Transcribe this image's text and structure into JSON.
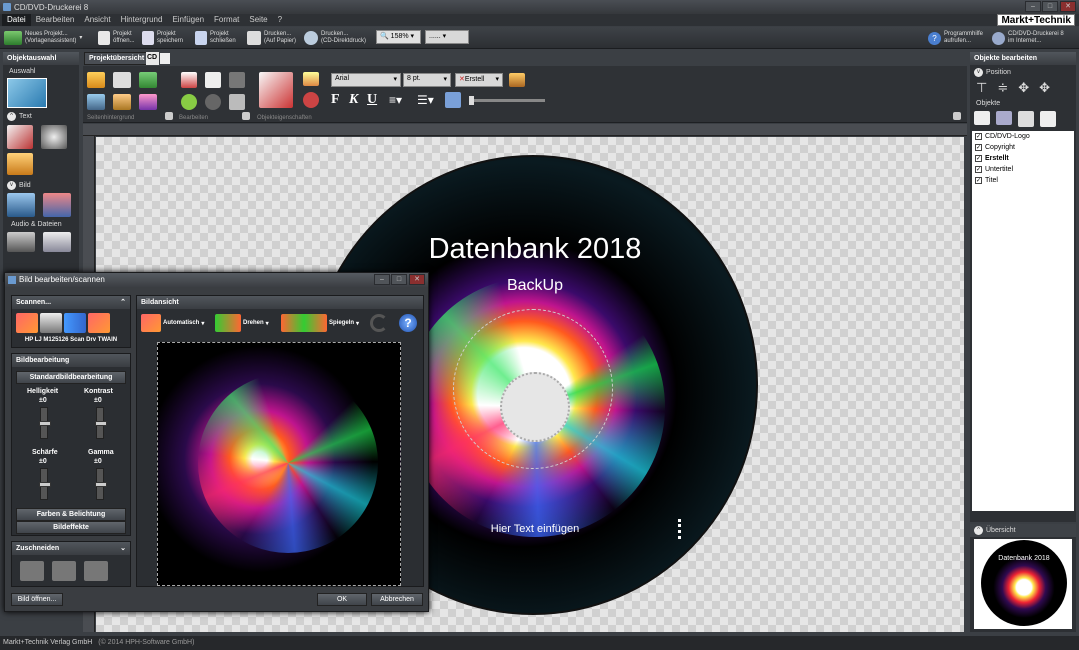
{
  "window": {
    "title": "CD/DVD-Druckerei 8"
  },
  "menu": {
    "items": [
      "Datei",
      "Bearbeiten",
      "Ansicht",
      "Hintergrund",
      "Einfügen",
      "Format",
      "Seite",
      "?"
    ]
  },
  "brand": "Markt+Technik",
  "toolbar": {
    "new_project": "Neues Projekt...\n(Vorlagenassistent)",
    "open_project": "Projekt\nöffnen...",
    "save_project": "Projekt\nspeichern",
    "close_project": "Projekt\nschließen",
    "print_paper": "Drucken...\n(Auf Papier)",
    "print_cd": "Drucken...\n(CD-Direktdruck)",
    "zoom": "158%",
    "zoom_box2": "......",
    "help": "Programmhilfe\naufrufen...",
    "internet": "CD/DVD-Druckerei 8\nim Internet..."
  },
  "left_panel": {
    "title": "Objektauswahl",
    "selection": "Auswahl",
    "sections": [
      "Text",
      "Bild",
      "Audio & Dateien"
    ]
  },
  "tabs": {
    "project_overview": "Projektübersicht",
    "cd_tab": "CD"
  },
  "ribbon": {
    "groups": [
      "Seitenhintergrund",
      "Bearbeiten",
      "Objekteigenschaften"
    ],
    "font": "Arial",
    "size": "8 pt.",
    "layer": "Erstell"
  },
  "cd": {
    "title": "Datenbank 2018",
    "subtitle": "BackUp",
    "placeholder": "Hier Text einfügen"
  },
  "right_panel": {
    "title": "Objekte bearbeiten",
    "position_label": "Position",
    "objects_label": "Objekte",
    "objects": [
      {
        "name": "CD/DVD-Logo",
        "checked": true,
        "bold": false
      },
      {
        "name": "Copyright",
        "checked": true,
        "bold": false
      },
      {
        "name": "Erstellt",
        "checked": true,
        "bold": true
      },
      {
        "name": "Untertitel",
        "checked": true,
        "bold": false
      },
      {
        "name": "Titel",
        "checked": true,
        "bold": false
      }
    ],
    "overview_label": "Übersicht",
    "overview_title": "Datenbank 2018"
  },
  "dialog": {
    "title": "Bild bearbeiten/scannen",
    "scan_header": "Scannen...",
    "scanner": "HP LJ M125126 Scan Drv TWAIN",
    "edit_header": "Bildbearbeitung",
    "standard": "Standardbildbearbeitung",
    "brightness": "Helligkeit",
    "contrast": "Kontrast",
    "sharpness": "Schärfe",
    "gamma": "Gamma",
    "zero": "±0",
    "colors": "Farben & Belichtung",
    "effects": "Bildeffekte",
    "crop": "Zuschneiden",
    "view_header": "Bildansicht",
    "auto": "Automatisch",
    "rotate": "Drehen",
    "mirror": "Spiegeln",
    "open_btn": "Bild öffnen...",
    "ok": "OK",
    "cancel": "Abbrechen"
  },
  "status": {
    "publisher": "Markt+Technik Verlag GmbH",
    "copyright": "(© 2014 HPH-Software GmbH)"
  }
}
